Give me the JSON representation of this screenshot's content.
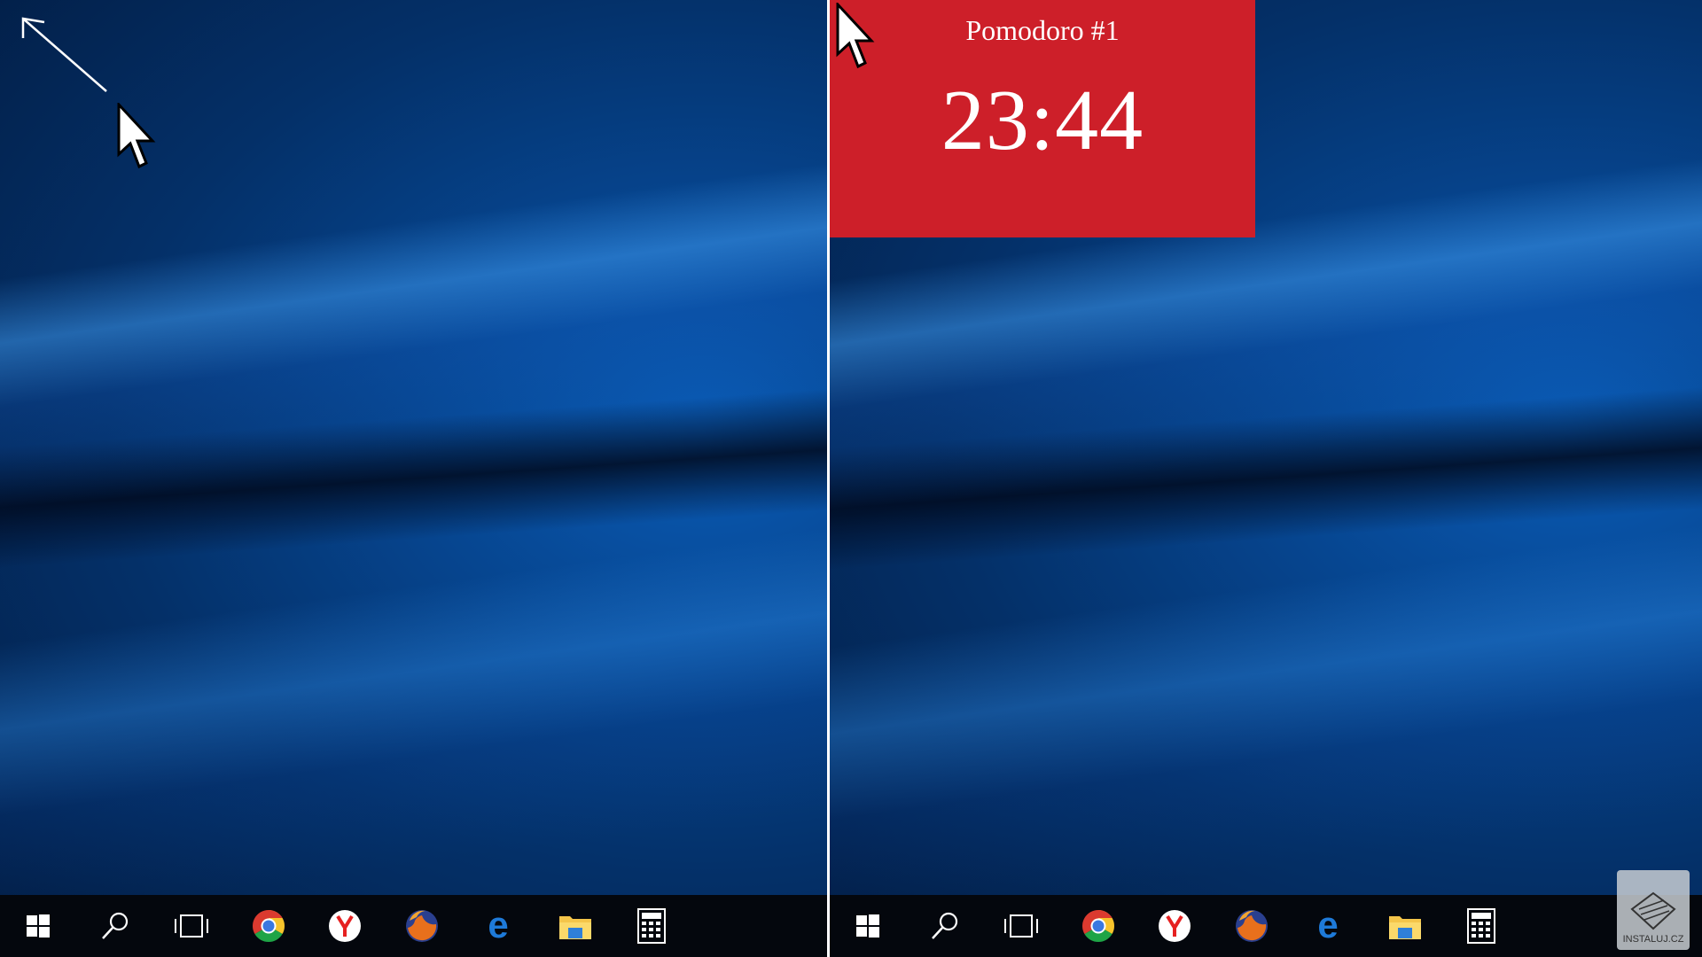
{
  "widget": {
    "title": "Pomodoro #1",
    "time": "23:44",
    "background_color": "#cd1f29"
  },
  "taskbar": {
    "items": [
      {
        "name": "start-button",
        "icon": "windows-logo-icon"
      },
      {
        "name": "search-button",
        "icon": "search-icon"
      },
      {
        "name": "task-view-button",
        "icon": "task-view-icon"
      },
      {
        "name": "chrome-button",
        "icon": "chrome-icon"
      },
      {
        "name": "yandex-button",
        "icon": "yandex-browser-icon"
      },
      {
        "name": "firefox-button",
        "icon": "firefox-icon"
      },
      {
        "name": "edge-button",
        "icon": "edge-icon"
      },
      {
        "name": "file-explorer-button",
        "icon": "folder-icon"
      },
      {
        "name": "calculator-button",
        "icon": "calculator-icon"
      }
    ]
  },
  "watermark": {
    "text": "INSTALUJ.CZ"
  }
}
